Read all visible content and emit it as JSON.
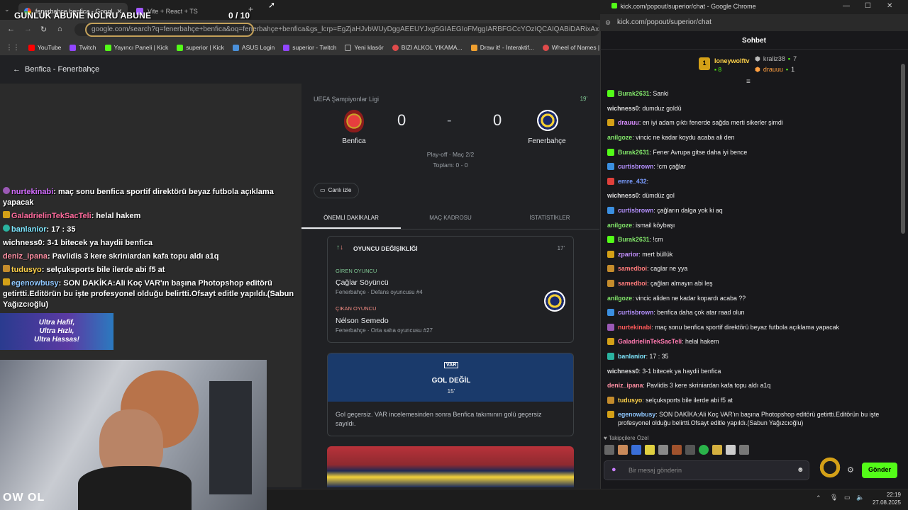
{
  "browser": {
    "tabs": [
      {
        "label": "fenerbahce benfica - Google'd"
      },
      {
        "label": "Vite + React + TS"
      }
    ],
    "overlay_title": "GUNLUK ABUNE NOLRU ABUNE",
    "overlay_count": "0  / 10",
    "url": "google.com/search?q=fenerbahçe+benfica&oq=fenerbahçe+benfica&gs_lcrp=EgZjaHJvbWUyDggAEEUYJxg5GIAEGIoFMggIARBFGCcYOzIQCAIQABiDARixAxiABBiKBTINCAMQ",
    "bookmarks": [
      {
        "label": "YouTube",
        "color": "#ff0000"
      },
      {
        "label": "Twitch",
        "color": "#9146ff"
      },
      {
        "label": "Yayıncı Paneli | Kick",
        "color": "#53fc18"
      },
      {
        "label": "superior | Kick",
        "color": "#53fc18"
      },
      {
        "label": "ASUS Login",
        "color": "#4a90d9"
      },
      {
        "label": "superior - Twitch",
        "color": "#9146ff"
      },
      {
        "label": "Yeni klasör",
        "color": "#aaaaaa"
      },
      {
        "label": "BIZI ALKOL YIKAMA...",
        "color": "#e04b4b"
      },
      {
        "label": "Draw it! - İnteraktif...",
        "color": "#f0a030"
      },
      {
        "label": "Wheel of Names | R...",
        "color": "#e04b4b"
      }
    ]
  },
  "google": {
    "back_label": "Benfica - Fenerbahçe",
    "competition": "UEFA Şampiyonlar Ligi",
    "minute": "19'",
    "home": {
      "name": "Benfica",
      "score": "0"
    },
    "away": {
      "name": "Fenerbahçe",
      "score": "0"
    },
    "separator": "-",
    "stage": "Play-off · Maç 2/2",
    "aggregate": "Toplam: 0 - 0",
    "live_button": "Canlı izle",
    "tabs": [
      "ÖNEMLİ DAKİKALAR",
      "MAÇ KADROSU",
      "İSTATİSTİKLER"
    ],
    "substitution": {
      "title": "OYUNCU DEĞİŞİKLİĞİ",
      "minute": "17'",
      "in_label": "GİREN OYUNCU",
      "in_name": "Çağlar Söyüncü",
      "in_detail": "Fenerbahçe · Defans oyuncusu #4",
      "out_label": "ÇIKAN OYUNCU",
      "out_name": "Nélson Semedo",
      "out_detail": "Fenerbahçe · Orta saha oyuncusu #27"
    },
    "var": {
      "icon_label": "VAR",
      "title": "GOL DEĞİL",
      "minute": "15'",
      "description": "Gol geçersiz. VAR incelemesinden sonra Benfica takımının golü geçersiz sayıldı."
    }
  },
  "stream_chat": [
    {
      "user": "nurtekinabi",
      "color": "#d36cff",
      "text": " maç sonu benfica sportif direktörü beyaz futbola açıklama yapacak"
    },
    {
      "user": "GaladrielinTekSacTeli",
      "color": "#ff6b9d",
      "text": " helal hakem"
    },
    {
      "user": "banlanior",
      "color": "#7fe7ff",
      "text": " 17 : 35"
    },
    {
      "user": "wichness0",
      "color": "#ffffff",
      "text": " 3-1 bitecek ya haydii benfica"
    },
    {
      "user": "deniz_ipana",
      "color": "#ff8fa3",
      "text": " Pavlidis 3 kere skriniardan kafa topu aldı a1q"
    },
    {
      "user": "tudusyo",
      "color": "#ffd24a",
      "text": " selçuksports bile ilerde abi f5 at"
    },
    {
      "user": "egenowbusy",
      "color": "#8fc7ff",
      "text": " SON DAKİKA:Ali Koç VAR'ın başına Photopshop editörü getirtti.Editörün bu işte profesyonel olduğu belirtti.Ofsayt editle yapıldı.(Sabun Yağızcıoğlu)"
    }
  ],
  "ad": {
    "line1": "Ultra Hafif,",
    "line2": "Ultra Hızlı,",
    "line3": "Ultra Hassas!"
  },
  "webcam_logo": "OW OL",
  "popup": {
    "window_title": "kick.com/popout/superior/chat - Google Chrome",
    "url": "kick.com/popout/superior/chat",
    "chat_title": "Sohbet",
    "leaderboard": [
      {
        "name": "loneywolftv",
        "count": "8",
        "rank": "1",
        "color": "#ffd24a"
      },
      {
        "name": "kraliz38",
        "count": "7",
        "color": "#bbbbbb"
      },
      {
        "name": "drauuu",
        "count": "1",
        "color": "#ff9f40"
      }
    ],
    "messages": [
      {
        "user": "Burak2631",
        "color": "#82e66a",
        "text": "Sanki",
        "badge": "#53fc18"
      },
      {
        "user": "wichness0",
        "color": "#dddddd",
        "text": "dumduz goldü",
        "badge": ""
      },
      {
        "user": "drauuu",
        "color": "#d98eff",
        "text": "en iyi adam çıktı fenerde sağda merti sikerler şimdi",
        "badge": "#d4a017"
      },
      {
        "user": "anilgoze",
        "color": "#82e66a",
        "text": "vincic ne kadar koydu acaba ali den",
        "badge": ""
      },
      {
        "user": "Burak2631",
        "color": "#82e66a",
        "text": "Fener Avrupa gitse daha iyi bence",
        "badge": "#53fc18"
      },
      {
        "user": "curtisbrown",
        "color": "#b591ff",
        "text": "!cm çağlar",
        "badge": "#3b8fe0"
      },
      {
        "user": "emre_432",
        "color": "#7a9cff",
        "text": "",
        "badge": "#e0403b"
      },
      {
        "user": "wichness0",
        "color": "#dddddd",
        "text": "dümdüz gol",
        "badge": ""
      },
      {
        "user": "curtisbrown",
        "color": "#b591ff",
        "text": "çağların dalga yok ki aq",
        "badge": "#3b8fe0"
      },
      {
        "user": "anilgoze",
        "color": "#82e66a",
        "text": "ismail köybaşı",
        "badge": ""
      },
      {
        "user": "Burak2631",
        "color": "#82e66a",
        "text": "!cm",
        "badge": "#53fc18"
      },
      {
        "user": "zparior",
        "color": "#c490ff",
        "text": "mert büllük",
        "badge": "#d4a017"
      },
      {
        "user": "samedboi",
        "color": "#ff7b7b",
        "text": "caglar ne yya",
        "badge": "#c58c2c"
      },
      {
        "user": "samedboi",
        "color": "#ff7b7b",
        "text": "çağları almayın abi leş",
        "badge": "#c58c2c"
      },
      {
        "user": "anilgoze",
        "color": "#82e66a",
        "text": "vincic aliden ne kadar kopardı acaba ??",
        "badge": ""
      },
      {
        "user": "curtisbrown",
        "color": "#b591ff",
        "text": "benfica daha çok atar raad olun",
        "badge": "#3b8fe0"
      },
      {
        "user": "nurtekinabi",
        "color": "#ff5a5a",
        "text": "maç sonu benfica sportif direktörü beyaz futbola açıklama yapacak",
        "badge": "#9b59b6"
      },
      {
        "user": "GaladrielinTekSacTeli",
        "color": "#ff7ab0",
        "text": "helal hakem",
        "badge": "#d4a017"
      },
      {
        "user": "banlanior",
        "color": "#7fe7ff",
        "text": "17 : 35",
        "badge": "#2ab3a0"
      },
      {
        "user": "wichness0",
        "color": "#dddddd",
        "text": "3-1 bitecek ya haydii benfica",
        "badge": ""
      },
      {
        "user": "deniz_ipana",
        "color": "#ff8fa3",
        "text": "Pavlidis 3 kere skriniardan kafa topu aldı a1q",
        "badge": ""
      },
      {
        "user": "tudusyo",
        "color": "#ffd24a",
        "text": "selçuksports bile ilerde abi f5 at",
        "badge": "#c58c2c"
      },
      {
        "user": "egenowbusy",
        "color": "#8fc7ff",
        "text": "SON DAKİKA:Ali Koç VAR'ın başına Photopshop editörü getirtti.Editörün bu işte profesyonel olduğu belirtti.Ofsayt editle yapıldı.(Sabun Yağızcıoğlu)",
        "badge": "#d4a017"
      }
    ],
    "followers_label": "Takipçilere Özel",
    "input_placeholder": "Bir mesaj gönderin",
    "send_label": "Gönder"
  },
  "taskbar": {
    "time": "22:19",
    "date": "27.08.2025"
  }
}
